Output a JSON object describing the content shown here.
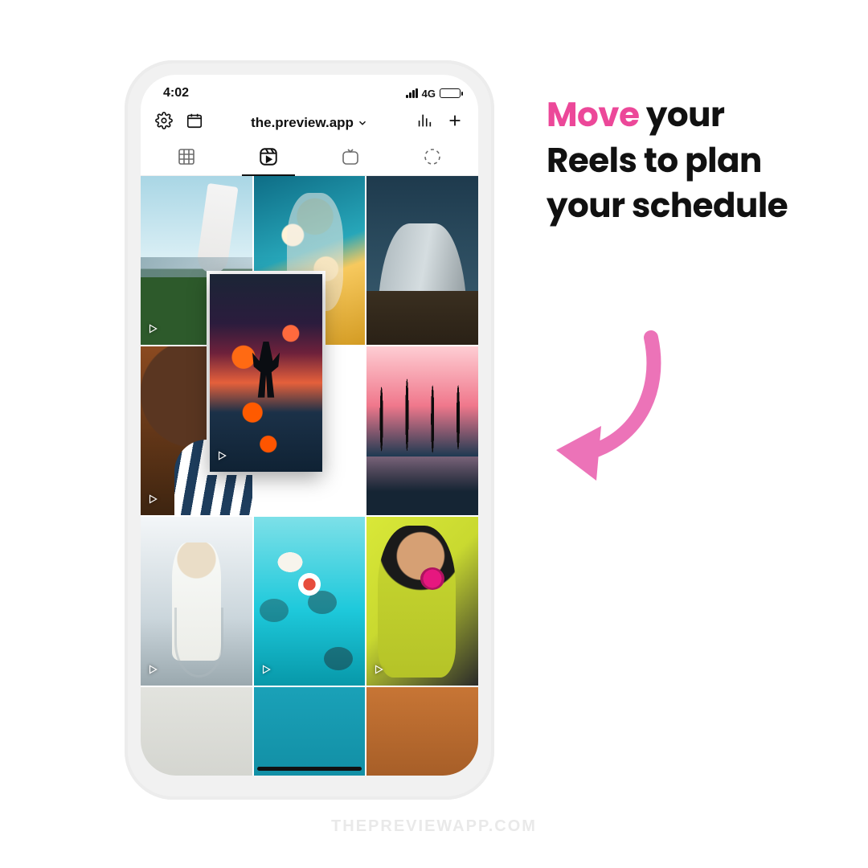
{
  "statusbar": {
    "time": "4:02",
    "network": "4G"
  },
  "appbar": {
    "account": "the.preview.app"
  },
  "tabs": {
    "grid": "grid",
    "reels": "reels",
    "igtv": "igtv",
    "story": "story",
    "active_index": 1
  },
  "dragging_tile": {
    "has_video_badge": true
  },
  "grid_tiles": [
    {
      "id": "tile-1",
      "has_video_badge": true
    },
    {
      "id": "tile-2",
      "has_video_badge": false
    },
    {
      "id": "tile-3",
      "has_video_badge": true
    },
    {
      "id": "tile-4",
      "has_video_badge": true
    },
    {
      "id": "tile-5-empty",
      "empty": true
    },
    {
      "id": "tile-6",
      "has_video_badge": true
    },
    {
      "id": "tile-7",
      "has_video_badge": true
    },
    {
      "id": "tile-8",
      "has_video_badge": true
    },
    {
      "id": "tile-9",
      "has_video_badge": true
    }
  ],
  "caption": {
    "accent_word": "Move",
    "rest": " your Reels to plan your schedule"
  },
  "watermark": "THEPREVIEWAPP.COM",
  "colors": {
    "accent_pink": "#ec4899",
    "arrow_pink": "#ec73b8"
  }
}
